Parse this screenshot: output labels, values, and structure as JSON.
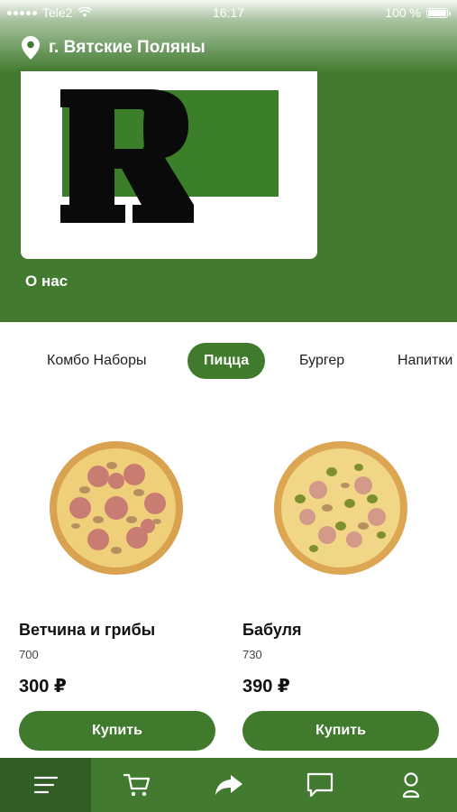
{
  "status_bar": {
    "carrier": "Tele2",
    "time": "16:17",
    "battery": "100 %"
  },
  "header": {
    "location": "г. Вятские Поляны",
    "about_label": "О нас",
    "logo_icon": "R-logo"
  },
  "categories": {
    "items": [
      {
        "label": "Комбо Наборы",
        "active": false
      },
      {
        "label": "Пицца",
        "active": true
      },
      {
        "label": "Бургер",
        "active": false
      },
      {
        "label": "Напитки",
        "active": false
      }
    ]
  },
  "products": [
    {
      "name": "Ветчина и грибы",
      "weight": "700",
      "price": "300 ₽",
      "buy_label": "Купить"
    },
    {
      "name": "Бабуля",
      "weight": "730",
      "price": "390 ₽",
      "buy_label": "Купить"
    }
  ],
  "bottom_nav": {
    "items": [
      {
        "icon": "menu-icon",
        "active": true
      },
      {
        "icon": "cart-icon",
        "active": false
      },
      {
        "icon": "share-icon",
        "active": false
      },
      {
        "icon": "chat-icon",
        "active": false
      },
      {
        "icon": "profile-icon",
        "active": false
      }
    ]
  },
  "colors": {
    "brand_green": "#427b30",
    "button_green": "#3f7a2d",
    "nav_active": "#325d24"
  }
}
